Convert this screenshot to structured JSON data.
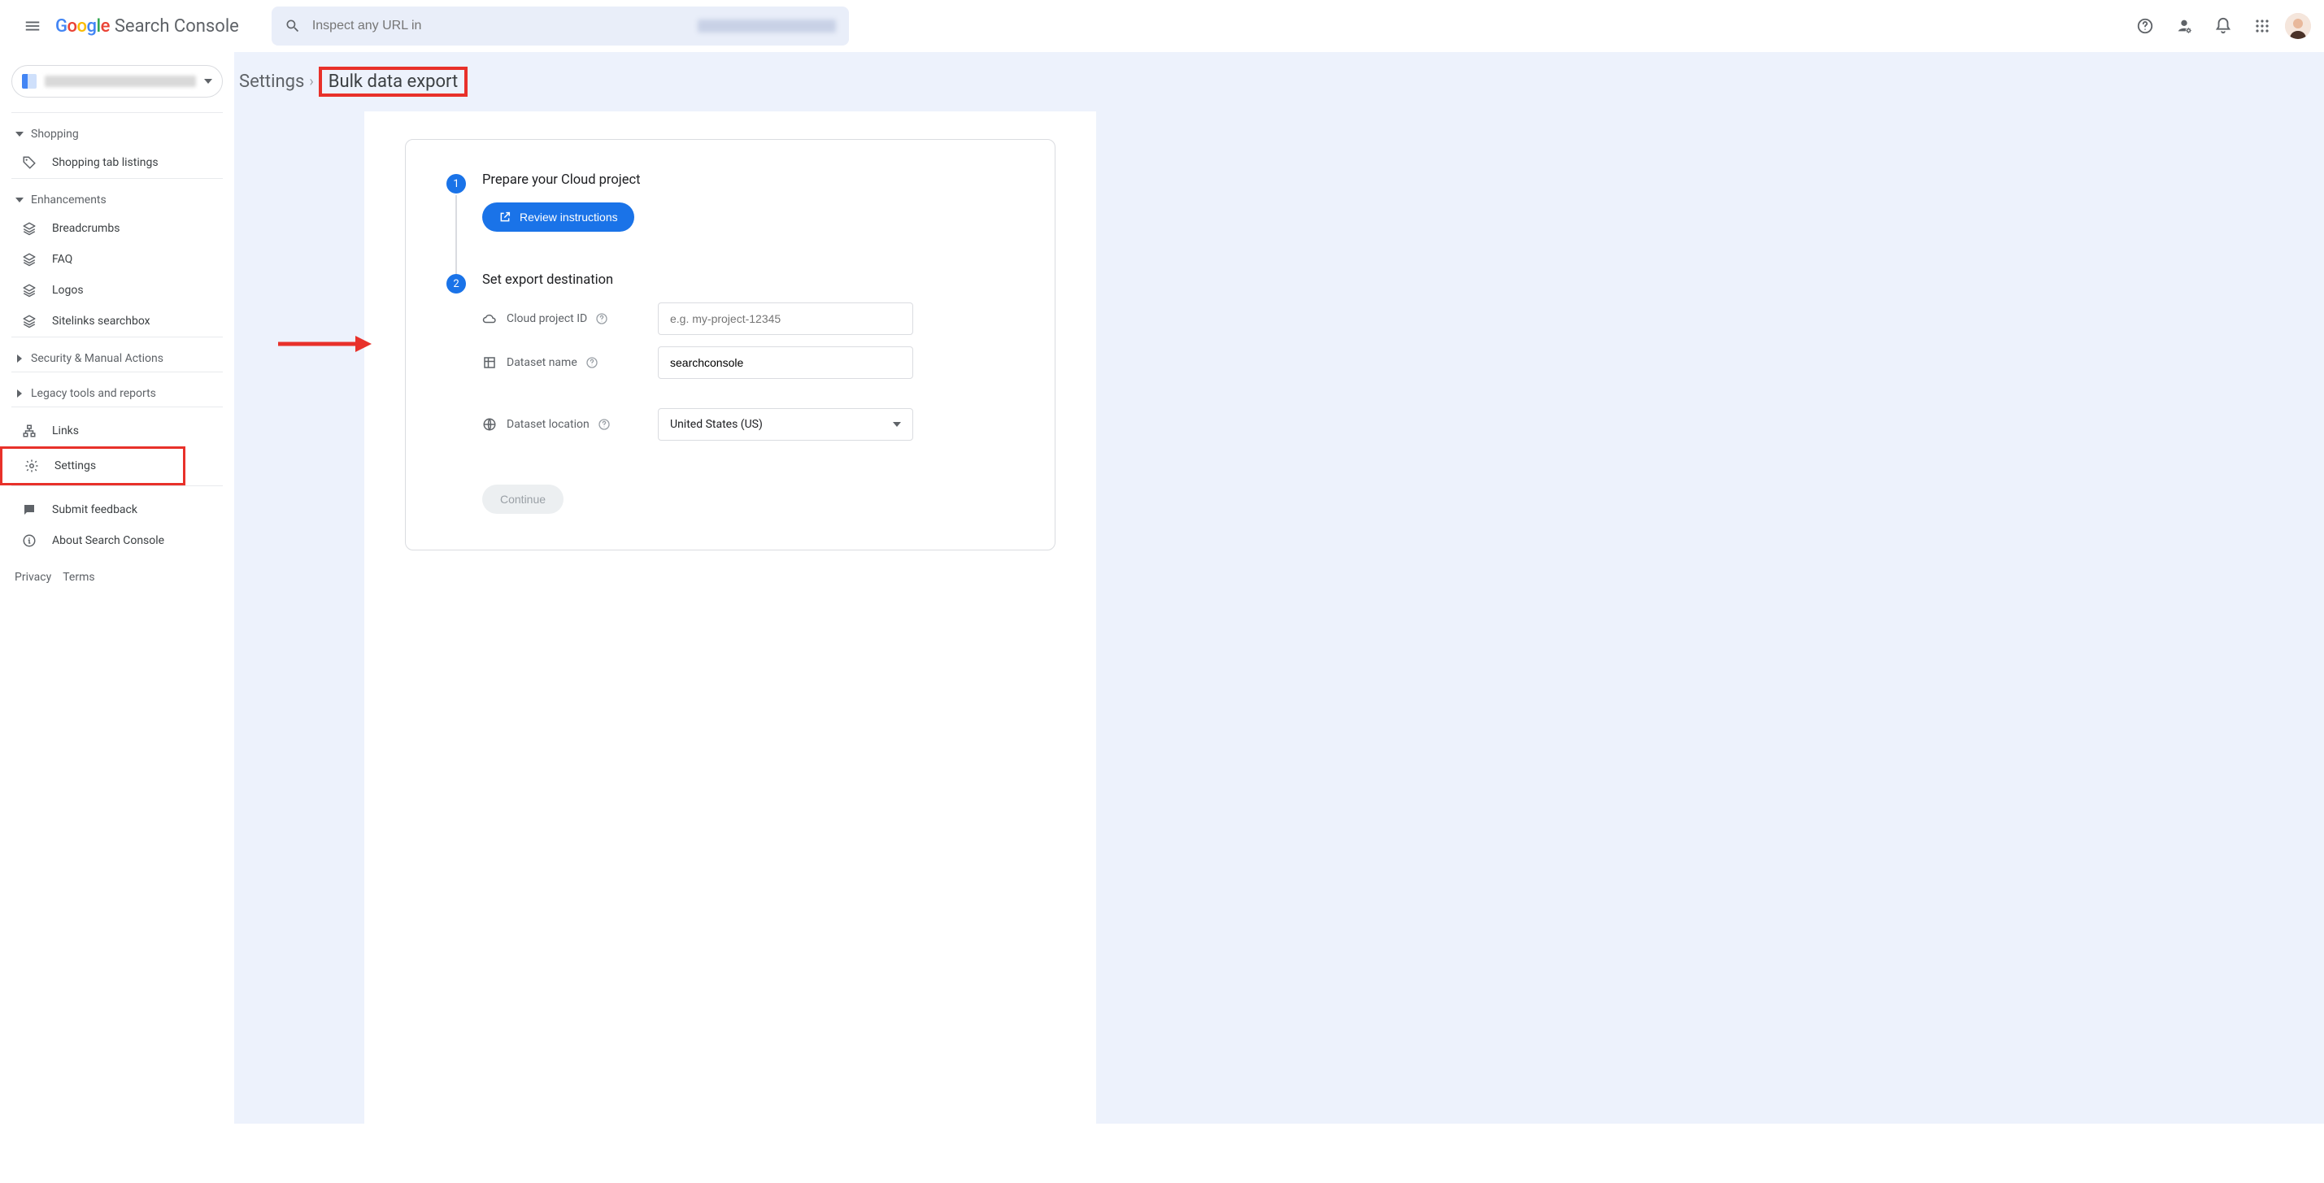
{
  "header": {
    "product": "Search Console",
    "search_placeholder": "Inspect any URL in"
  },
  "sidebar": {
    "sections": {
      "shopping": {
        "label": "Shopping",
        "items": [
          "Shopping tab listings"
        ]
      },
      "enhancements": {
        "label": "Enhancements",
        "items": [
          "Breadcrumbs",
          "FAQ",
          "Logos",
          "Sitelinks searchbox"
        ]
      },
      "security": {
        "label": "Security & Manual Actions"
      },
      "legacy": {
        "label": "Legacy tools and reports"
      }
    },
    "links": "Links",
    "settings": "Settings",
    "feedback": "Submit feedback",
    "about": "About Search Console",
    "footer": {
      "privacy": "Privacy",
      "terms": "Terms"
    }
  },
  "breadcrumb": {
    "parent": "Settings",
    "current": "Bulk data export"
  },
  "steps": {
    "s1": {
      "num": "1",
      "title": "Prepare your Cloud project",
      "button": "Review instructions"
    },
    "s2": {
      "num": "2",
      "title": "Set export destination",
      "fields": {
        "project": {
          "label": "Cloud project ID",
          "placeholder": "e.g. my-project-12345"
        },
        "dataset": {
          "label": "Dataset name",
          "value": "searchconsole"
        },
        "location": {
          "label": "Dataset location",
          "value": "United States (US)"
        }
      },
      "continue": "Continue"
    }
  }
}
